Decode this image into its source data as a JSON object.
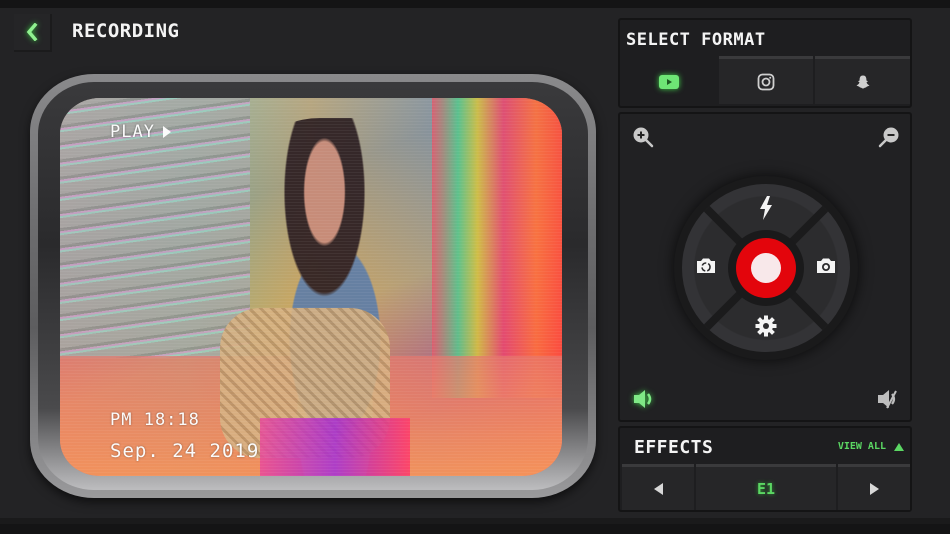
{
  "header": {
    "back_icon": "chevron-left-icon",
    "title": "RECORDING"
  },
  "screen": {
    "play_label": "PLAY",
    "play_icon": "play-triangle-icon",
    "time": "PM 18:18",
    "date": "Sep. 24 2019"
  },
  "format": {
    "title": "SELECT FORMAT",
    "tabs": [
      {
        "icon": "youtube-icon",
        "active": true
      },
      {
        "icon": "instagram-icon",
        "active": false
      },
      {
        "icon": "snapchat-icon",
        "active": false
      }
    ]
  },
  "controls": {
    "zoom_in_icon": "zoom-in-icon",
    "zoom_out_icon": "zoom-out-icon",
    "flash_icon": "flash-icon",
    "switch_camera_icon": "switch-camera-icon",
    "photo_icon": "camera-icon",
    "settings_icon": "gear-icon",
    "record_icon": "record-icon",
    "sound_on_icon": "volume-on-icon",
    "sound_off_icon": "volume-mute-icon"
  },
  "effects": {
    "title": "EFFECTS",
    "view_all": "VIEW ALL",
    "current": "E1"
  },
  "colors": {
    "accent_green": "#5bd763",
    "record_red": "#e3050c",
    "background": "#232325"
  }
}
